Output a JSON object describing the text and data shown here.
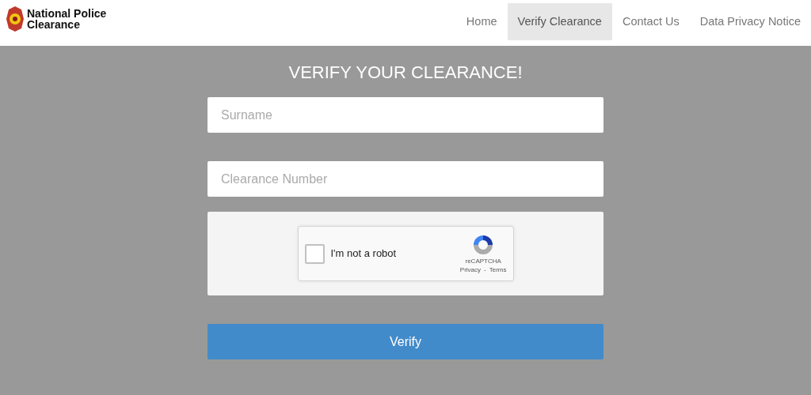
{
  "brand": {
    "line_1": "National Police",
    "line_2": "Clearance"
  },
  "nav": [
    {
      "label": "Home",
      "selected": false
    },
    {
      "label": "Verify Clearance",
      "selected": true
    },
    {
      "label": "Contact Us",
      "selected": false
    },
    {
      "label": "Data Privacy Notice",
      "selected": false
    }
  ],
  "heading": "VERIFY YOUR CLEARANCE!",
  "fields": [
    {
      "placeholder": "Surname"
    },
    {
      "placeholder": "Clearance Number"
    }
  ],
  "captcha": {
    "label": "I'm not a robot",
    "checked": false,
    "brand": "reCAPTCHA",
    "privacy": "Privacy",
    "separator": "-",
    "terms": "Terms"
  },
  "submit": "Verify"
}
